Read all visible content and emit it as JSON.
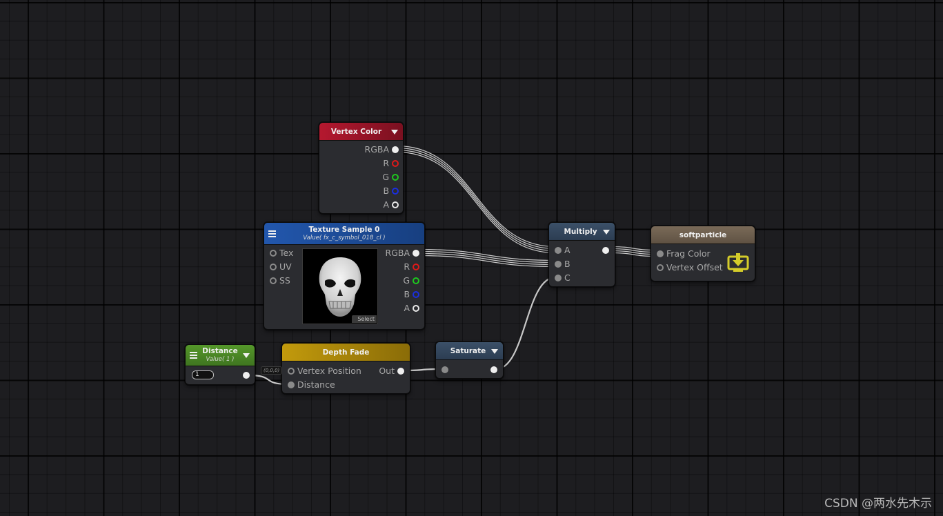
{
  "graph": {
    "nodes": {
      "vertex_color": {
        "title": "Vertex Color",
        "header_color": "#a3172c",
        "outputs": [
          "RGBA",
          "R",
          "G",
          "B",
          "A"
        ]
      },
      "texture_sample": {
        "title": "Texture Sample 0",
        "subtitle": "Value( fx_c_symbol_018_cl )",
        "header_color": "#1d4f9e",
        "inputs": [
          "Tex",
          "UV",
          "SS"
        ],
        "outputs": [
          "RGBA",
          "R",
          "G",
          "B",
          "A"
        ],
        "preview_button": "Select",
        "preview_icon": "skull-texture"
      },
      "multiply": {
        "title": "Multiply",
        "header_color": "#33465c",
        "inputs": [
          "A",
          "B",
          "C"
        ]
      },
      "softparticle": {
        "title": "softparticle",
        "header_color": "#6d5f4f",
        "inputs": [
          "Frag Color",
          "Vertex Offset"
        ],
        "icon": "master-output-icon",
        "icon_color": "#d4cc2a"
      },
      "distance": {
        "title": "Distance",
        "subtitle": "Value( 1 )",
        "header_color": "#4a8a24",
        "value": "1"
      },
      "depth_fade": {
        "title": "Depth Fade",
        "header_color": "#b8930c",
        "inputs": [
          "Vertex Position",
          "Distance"
        ],
        "outputs": [
          "Out"
        ],
        "default_tag": "(0,0,0)"
      },
      "saturate": {
        "title": "Saturate",
        "header_color": "#33465c"
      }
    },
    "connections": [
      {
        "from": "Vertex Color.RGBA",
        "to": "Multiply.A",
        "channels": 4
      },
      {
        "from": "Texture Sample 0.RGBA",
        "to": "Multiply.B",
        "channels": 4
      },
      {
        "from": "Saturate.Out",
        "to": "Multiply.C",
        "channels": 1
      },
      {
        "from": "Multiply.Out",
        "to": "softparticle.Frag Color",
        "channels": 4
      },
      {
        "from": "Distance.Out",
        "to": "Depth Fade.Distance",
        "channels": 1
      },
      {
        "from": "Depth Fade.Out",
        "to": "Saturate.In",
        "channels": 1
      }
    ]
  },
  "watermark": "CSDN @两水先木示"
}
